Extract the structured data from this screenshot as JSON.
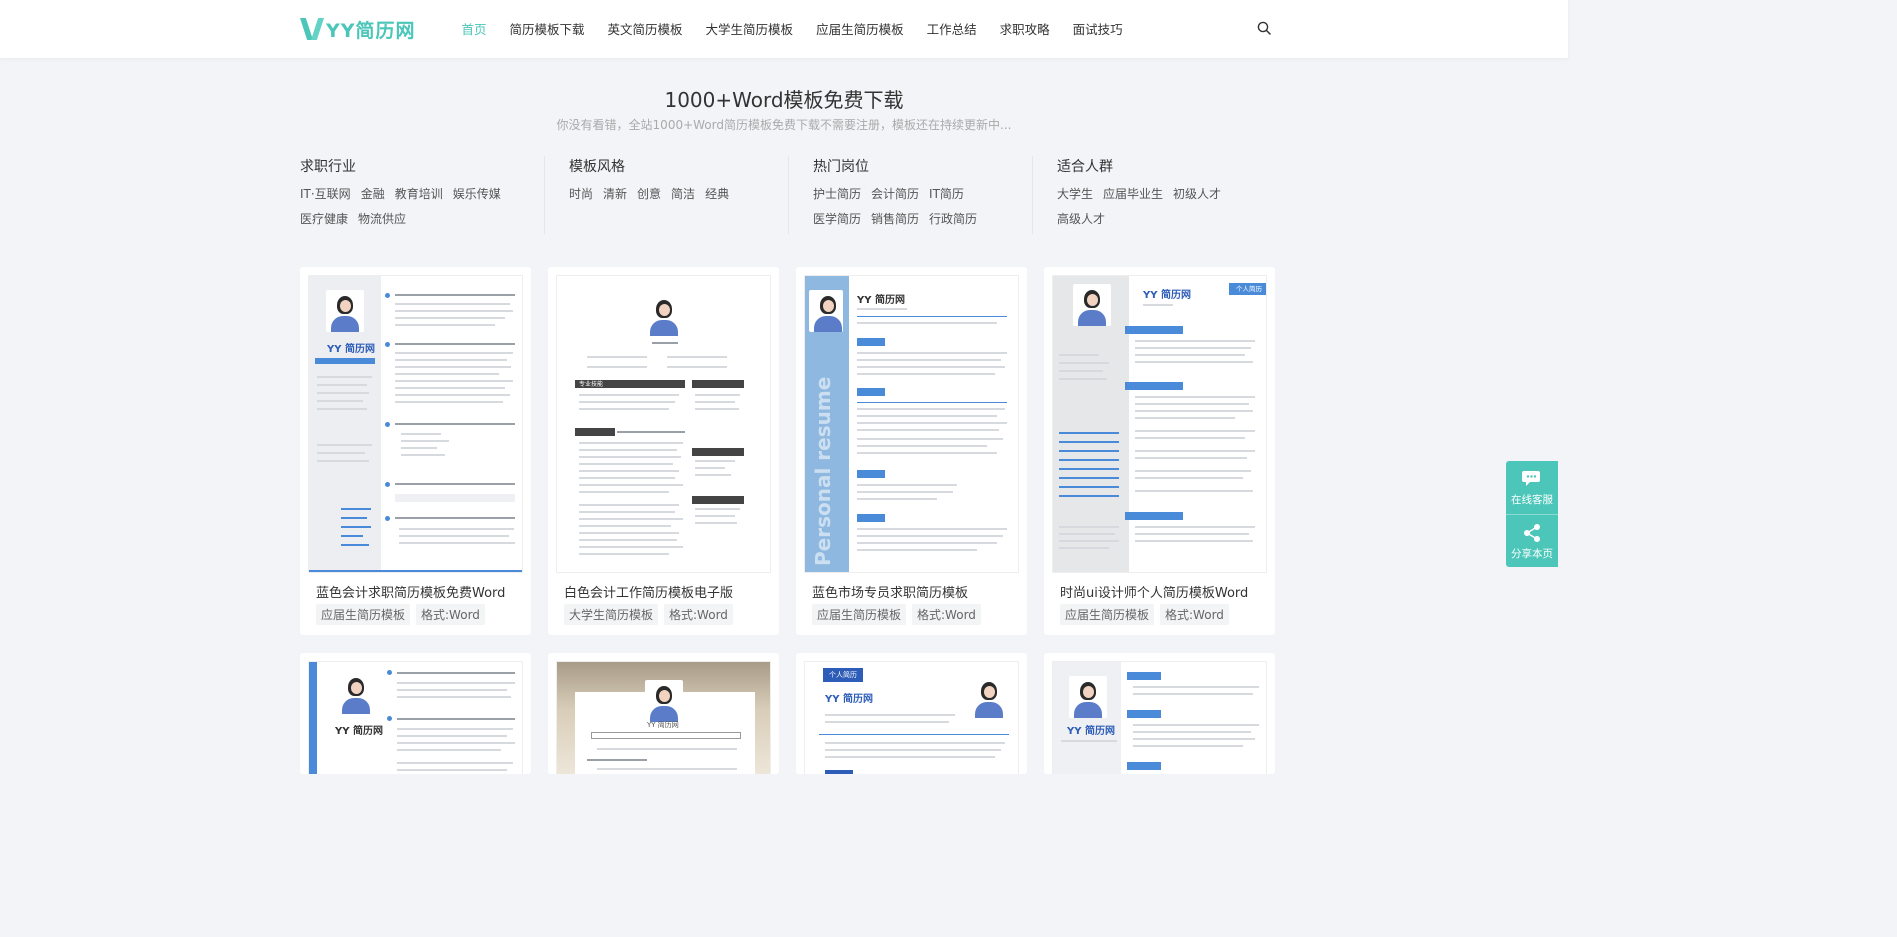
{
  "header": {
    "logo_text": "YY简历网",
    "nav": [
      "首页",
      "简历模板下载",
      "英文简历模板",
      "大学生简历模板",
      "应届生简历模板",
      "工作总结",
      "求职攻略",
      "面试技巧"
    ],
    "active_nav": "首页",
    "search_icon": "search-icon"
  },
  "hero": {
    "title": "1000+Word模板免费下载",
    "subtitle": "你没有看错，全站1000+Word简历模板免费下载不需要注册，模板还在持续更新中..."
  },
  "categories": [
    {
      "title": "求职行业",
      "links": [
        "IT·互联网",
        "金融",
        "教育培训",
        "娱乐传媒",
        "医疗健康",
        "物流供应"
      ]
    },
    {
      "title": "模板风格",
      "links": [
        "时尚",
        "清新",
        "创意",
        "简洁",
        "经典"
      ]
    },
    {
      "title": "热门岗位",
      "links": [
        "护士简历",
        "会计简历",
        "IT简历",
        "医学简历",
        "销售简历",
        "行政简历"
      ]
    },
    {
      "title": "适合人群",
      "links": [
        "大学生",
        "应届毕业生",
        "初级人才",
        "高级人才"
      ]
    }
  ],
  "cards": [
    {
      "title": "蓝色会计求职简历模板免费Word",
      "tags": [
        "应届生简历模板",
        "格式:Word"
      ]
    },
    {
      "title": "白色会计工作简历模板电子版",
      "tags": [
        "大学生简历模板",
        "格式:Word"
      ]
    },
    {
      "title": "蓝色市场专员求职简历模板",
      "tags": [
        "应届生简历模板",
        "格式:Word"
      ]
    },
    {
      "title": "时尚ui设计师个人简历模板Word",
      "tags": [
        "应届生简历模板",
        "格式:Word"
      ]
    }
  ],
  "previews": {
    "p1_name": "YY 简历网",
    "p2_section": "专业技能",
    "p3_name": "YY 简历网",
    "p3_vertical": "Personal resume",
    "p4_name": "YY 简历网",
    "p4_badge": "个人简历",
    "r5_name": "YY 简历网",
    "r6_name": "YY 简历网",
    "r7_badge": "个人简历",
    "r7_name": "YY 简历网",
    "r8_name": "YY 简历网"
  },
  "float": {
    "service": "在线客服",
    "share": "分享本页",
    "service_icon": "chat-icon",
    "share_icon": "share-icon"
  },
  "colors": {
    "accent": "#4bc6b9",
    "resume_blue": "#4a8bd9",
    "page_bg": "#f2f4f7"
  }
}
